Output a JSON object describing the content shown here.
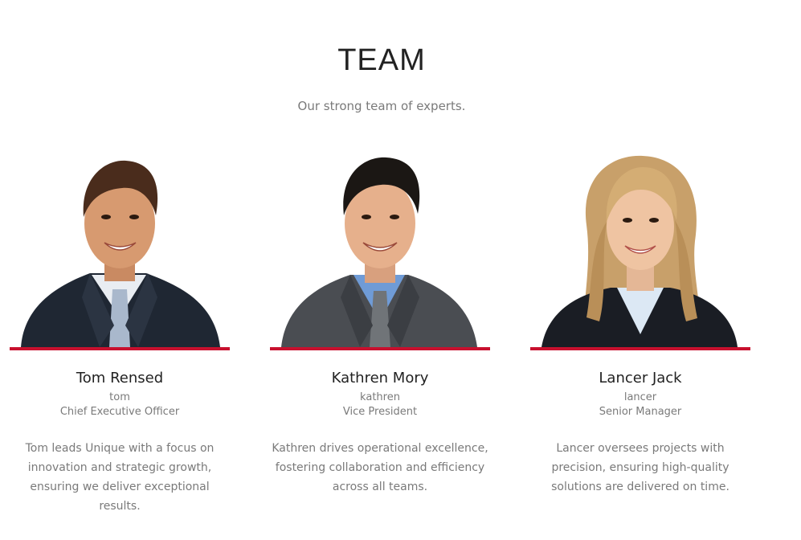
{
  "section": {
    "title": "TEAM",
    "subtitle": "Our strong team of experts."
  },
  "accent_color": "#c8102e",
  "members": [
    {
      "name": "Tom Rensed",
      "handle": "tom",
      "role": "Chief Executive Officer",
      "bio": "Tom leads Unique with a focus on innovation and strategic growth, ensuring we deliver exceptional results."
    },
    {
      "name": "Kathren Mory",
      "handle": "kathren",
      "role": "Vice President",
      "bio": "Kathren drives operational excellence, fostering collaboration and efficiency across all teams."
    },
    {
      "name": "Lancer Jack",
      "handle": "lancer",
      "role": "Senior Manager",
      "bio": "Lancer oversees projects with precision, ensuring high-quality solutions are delivered on time."
    }
  ]
}
